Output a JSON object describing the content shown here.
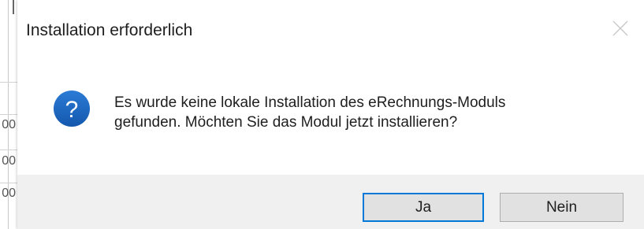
{
  "dialog": {
    "title": "Installation erforderlich",
    "message_line1": "Es wurde keine lokale Installation des eRechnungs-Moduls",
    "message_line2": "gefunden. Möchten Sie das Modul jetzt installieren?",
    "icon": "question-icon",
    "buttons": {
      "yes_label": "Ja",
      "no_label": "Nein",
      "default": "yes"
    }
  },
  "background_app": {
    "visible_cells": [
      "00",
      "00",
      "00"
    ]
  },
  "colors": {
    "accent": "#0078d7",
    "icon_blue": "#1e66c1",
    "footer_bg": "#f0f0f0",
    "button_bg": "#e1e1e1"
  }
}
